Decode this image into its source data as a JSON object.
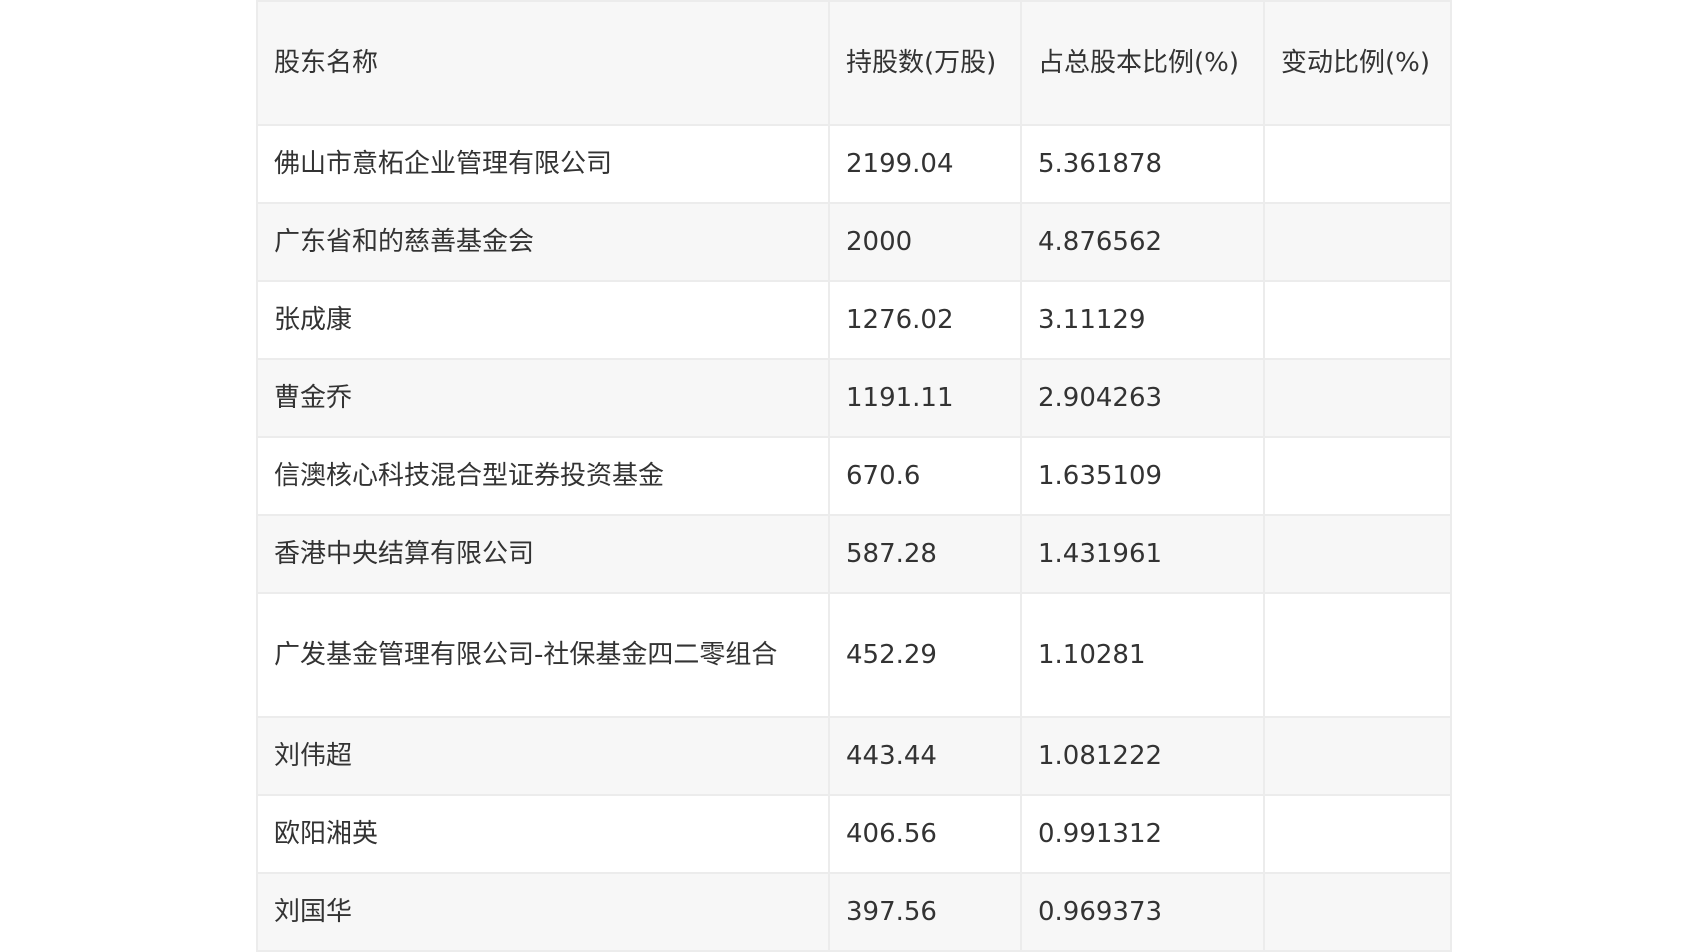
{
  "table": {
    "headers": {
      "name": "股东名称",
      "shares": "持股数(万股)",
      "ratio": "占总股本比例(%)",
      "change": "变动比例(%)"
    },
    "rows": [
      {
        "name": "佛山市意柘企业管理有限公司",
        "shares": "2199.04",
        "ratio": "5.361878",
        "change": ""
      },
      {
        "name": "广东省和的慈善基金会",
        "shares": "2000",
        "ratio": "4.876562",
        "change": ""
      },
      {
        "name": "张成康",
        "shares": "1276.02",
        "ratio": "3.11129",
        "change": ""
      },
      {
        "name": "曹金乔",
        "shares": "1191.11",
        "ratio": "2.904263",
        "change": ""
      },
      {
        "name": "信澳核心科技混合型证券投资基金",
        "shares": "670.6",
        "ratio": "1.635109",
        "change": ""
      },
      {
        "name": "香港中央结算有限公司",
        "shares": "587.28",
        "ratio": "1.431961",
        "change": ""
      },
      {
        "name": "广发基金管理有限公司-社保基金四二零组合",
        "shares": "452.29",
        "ratio": "1.10281",
        "change": ""
      },
      {
        "name": "刘伟超",
        "shares": "443.44",
        "ratio": "1.081222",
        "change": ""
      },
      {
        "name": "欧阳湘英",
        "shares": "406.56",
        "ratio": "0.991312",
        "change": ""
      },
      {
        "name": "刘国华",
        "shares": "397.56",
        "ratio": "0.969373",
        "change": ""
      }
    ]
  }
}
